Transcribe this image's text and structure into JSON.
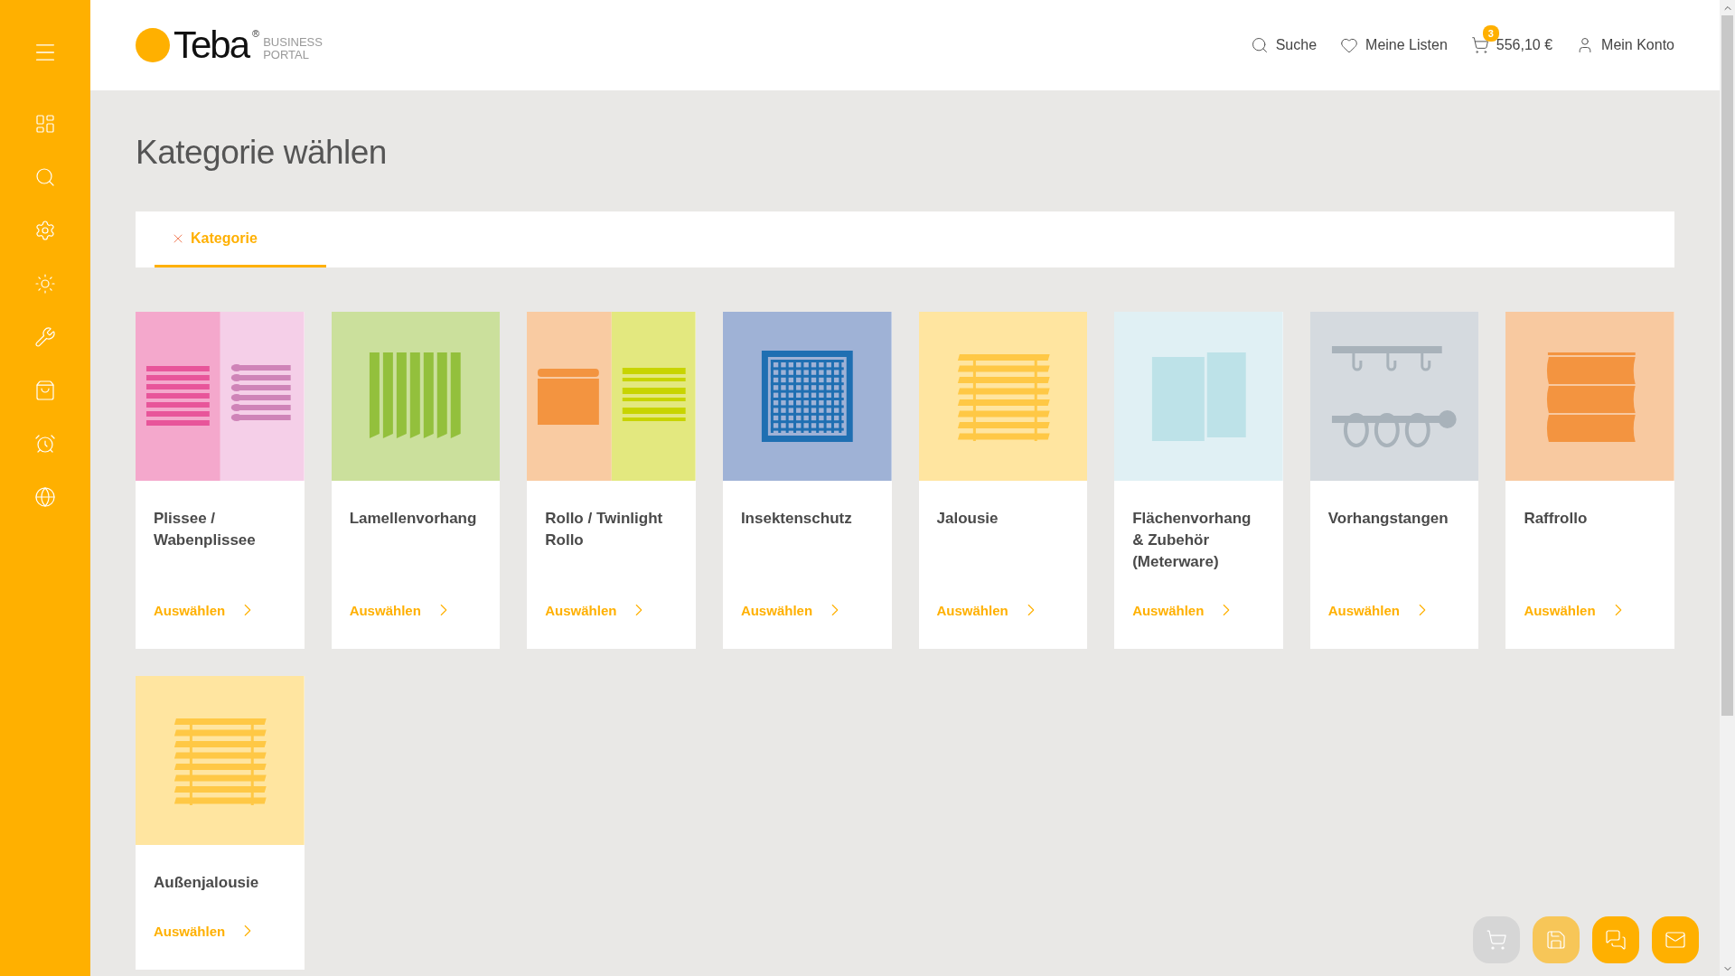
{
  "logo": {
    "name": "Teba",
    "mark": "®",
    "line_1": "BUSINESS",
    "line_2": "PORTAL"
  },
  "nav": [
    {
      "kind": "search",
      "label": "Suche"
    },
    {
      "kind": "lists",
      "label": "Meine Listen"
    },
    {
      "kind": "cart",
      "label": "556,10 €",
      "badge": "3"
    },
    {
      "kind": "account",
      "label": "Mein Konto"
    }
  ],
  "page_title": "Kategorie wählen",
  "filter": {
    "label": "Kategorie",
    "selected": true
  },
  "cards": [
    {
      "kind": "plissee",
      "title": "Plissee / Wabenplissee",
      "action": "Auswählen"
    },
    {
      "kind": "lamellen",
      "title": "Lamellenvorhang",
      "action": "Auswählen"
    },
    {
      "kind": "rollo",
      "title": "Rollo / Twinlight Rollo",
      "action": "Auswählen"
    },
    {
      "kind": "insekten",
      "title": "Insektenschutz",
      "action": "Auswählen"
    },
    {
      "kind": "jalousie",
      "title": "Jalousie",
      "action": "Auswählen"
    },
    {
      "kind": "flaechen",
      "title": "Flächenvorhang & Zubehör (Meterware)",
      "action": "Auswählen"
    },
    {
      "kind": "stangen",
      "title": "Vorhangstangen",
      "action": "Auswählen"
    },
    {
      "kind": "raffrollo",
      "title": "Raffrollo",
      "action": "Auswählen"
    },
    {
      "kind": "jalousie",
      "title": "Außenjalousie",
      "action": "Auswählen"
    }
  ],
  "actions": [
    {
      "kind": "cart",
      "disabled": true
    },
    {
      "kind": "save",
      "disabled": false
    },
    {
      "kind": "chat",
      "disabled": false
    },
    {
      "kind": "mail",
      "disabled": false
    }
  ]
}
